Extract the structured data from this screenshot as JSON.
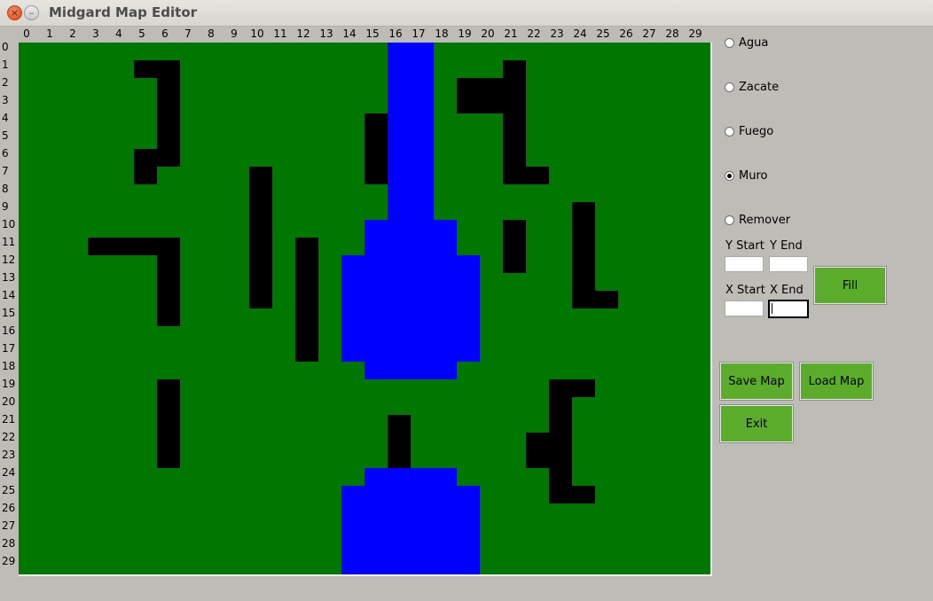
{
  "window": {
    "title": "Midgard Map Editor",
    "close_glyph": "×",
    "minimize_glyph": "–"
  },
  "grid": {
    "columns": [
      "0",
      "1",
      "2",
      "3",
      "4",
      "5",
      "6",
      "7",
      "8",
      "9",
      "10",
      "11",
      "12",
      "13",
      "14",
      "15",
      "16",
      "17",
      "18",
      "19",
      "20",
      "21",
      "22",
      "23",
      "24",
      "25",
      "26",
      "27",
      "28",
      "29"
    ],
    "rows": [
      "0",
      "1",
      "2",
      "3",
      "4",
      "5",
      "6",
      "7",
      "8",
      "9",
      "10",
      "11",
      "12",
      "13",
      "14",
      "15",
      "16",
      "17",
      "18",
      "19",
      "20",
      "21",
      "22",
      "23",
      "24",
      "25",
      "26",
      "27",
      "28",
      "29"
    ]
  },
  "map": {
    "colors": {
      "zacate": "#007800",
      "agua": "#0000ff",
      "muro": "#000000"
    },
    "cells": [
      "ZZZZZZZZZZZZZZZZAAZZZZZZZZZZZZ",
      "ZZZZZMMZZZZZZZZZAAZZZMZZZZZZZZ",
      "ZZZZZZMZZZZZZZZZAAZMMMZZZZZZZZ",
      "ZZZZZZMZZZZZZZZZAAZMMMZZZZZZZZ",
      "ZZZZZZMZZZZZZZZMAAZZZMZZZZZZZZ",
      "ZZZZZZMZZZZZZZZMAAZZZMZZZZZZZZ",
      "ZZZZZMMZZZZZZZZMAAZZZMZZZZZZZZ",
      "ZZZZZMZZZZMZZZZMAAZZZMMZZZZZZZ",
      "ZZZZZZZZZZMZZZZZAAZZZZZZZZZZZZ",
      "ZZZZZZZZZZMZZZZZAAZZZZZZMZZZZZ",
      "ZZZZZZZZZZMZZZZAAAAZZMZZMZZZZZ",
      "ZZZMMMMZZZMZMZZAAAAZZMZZMZZZZZ",
      "ZZZZZZMZZZMZMZAAAAAAZMZZMZZZZZ",
      "ZZZZZZMZZZMZMZAAAAAAZZZZMZZZZZ",
      "ZZZZZZMZZZMZMZAAAAAAZZZZMMZZZZ",
      "ZZZZZZMZZZZZMZAAAAAAZZZZZZZZZZ",
      "ZZZZZZZZZZZZMZAAAAAAZZZZZZZZZZ",
      "ZZZZZZZZZZZZMZAAAAAAZZZZZZZZZZ",
      "ZZZZZZZZZZZZZZZAAAAZZZZZZZZZZZ",
      "ZZZZZZMZZZZZZZZZZZZZZZZMMZZZZZ",
      "ZZZZZZMZZZZZZZZZZZZZZZZMZZZZZZ",
      "ZZZZZZMZZZZZZZZZMZZZZZZMZZZZZZ",
      "ZZZZZZMZZZZZZZZZMZZZZZMMZZZZZZ",
      "ZZZZZZMZZZZZZZZZMZZZZZMMZZZZZZ",
      "ZZZZZZZZZZZZZZZAAAAZZZZMZZZZZZ",
      "ZZZZZZZZZZZZZZAAAAAAZZZMMZZZZZ",
      "ZZZZZZZZZZZZZZAAAAAAZZZZZZZZZZ",
      "ZZZZZZZZZZZZZZAAAAAAZZZZZZZZZZ",
      "ZZZZZZZZZZZZZZAAAAAAZZZZZZZZZZ",
      "ZZZZZZZZZZZZZZAAAAAAZZZZZZZZZZ"
    ]
  },
  "tools": {
    "options": [
      {
        "label": "Agua",
        "checked": false
      },
      {
        "label": "Zacate",
        "checked": false
      },
      {
        "label": "Fuego",
        "checked": false
      },
      {
        "label": "Muro",
        "checked": true
      },
      {
        "label": "Remover",
        "checked": false
      }
    ]
  },
  "fill": {
    "y_start_label": "Y Start",
    "y_end_label": "Y End",
    "x_start_label": "X Start",
    "x_end_label": "X End",
    "y_start_value": "",
    "y_end_value": "",
    "x_start_value": "",
    "x_end_value": "",
    "fill_label": "Fill"
  },
  "actions": {
    "save_label": "Save Map",
    "load_label": "Load Map",
    "exit_label": "Exit"
  }
}
